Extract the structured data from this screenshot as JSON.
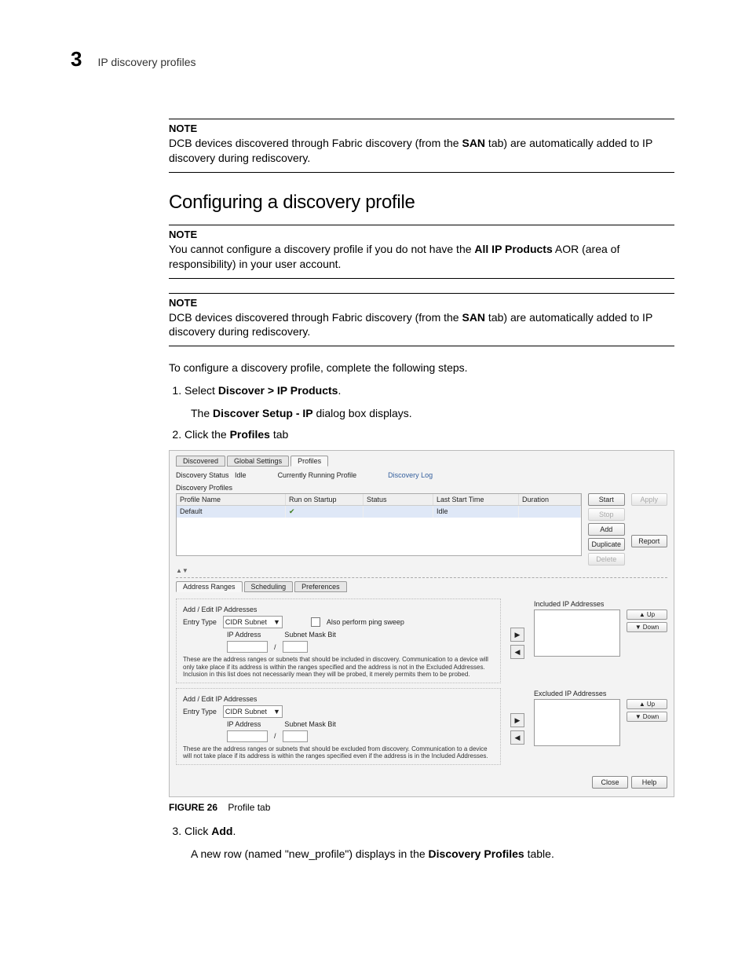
{
  "header": {
    "page_number": "3",
    "title": "IP discovery profiles"
  },
  "note1": {
    "label": "NOTE",
    "text_before": "DCB devices discovered through Fabric discovery (from the ",
    "bold": "SAN",
    "text_after": " tab) are automatically added to IP discovery during rediscovery."
  },
  "section_title": "Configuring a discovery profile",
  "note2": {
    "label": "NOTE",
    "text_before": "You cannot configure a discovery profile if you do not have the ",
    "bold": "All IP Products",
    "text_after": " AOR (area of responsibility) in your user account."
  },
  "note3": {
    "label": "NOTE",
    "text_before": "DCB devices discovered through Fabric discovery (from the ",
    "bold": "SAN",
    "text_after": " tab) are automatically added to IP discovery during rediscovery."
  },
  "intro": "To configure a discovery profile, complete the following steps.",
  "steps": {
    "s1_pre": "Select ",
    "s1_bold": "Discover > IP Products",
    "s1_post": ".",
    "s1_sub_pre": "The ",
    "s1_sub_bold": "Discover Setup - IP",
    "s1_sub_post": " dialog box displays.",
    "s2_pre": "Click the ",
    "s2_bold": "Profiles",
    "s2_post": " tab",
    "s3_pre": "Click ",
    "s3_bold": "Add",
    "s3_post": ".",
    "s3_sub_pre": "A new row (named \"new_profile\") displays in the ",
    "s3_sub_bold": "Discovery Profiles",
    "s3_sub_post": " table."
  },
  "figure": {
    "tabs": {
      "discovered": "Discovered",
      "global": "Global Settings",
      "profiles": "Profiles"
    },
    "statusrow": {
      "ds_label": "Discovery Status",
      "ds_value": "Idle",
      "crp_label": "Currently Running Profile",
      "dlog": "Discovery Log"
    },
    "dp_label": "Discovery Profiles",
    "cols": {
      "name": "Profile Name",
      "run": "Run on Startup",
      "status": "Status",
      "last": "Last Start Time",
      "dur": "Duration"
    },
    "row": {
      "name": "Default",
      "status": "Idle"
    },
    "btns": {
      "start": "Start",
      "apply": "Apply",
      "stop": "Stop",
      "add": "Add",
      "duplicate": "Duplicate",
      "report": "Report",
      "delete": "Delete"
    },
    "subtabs": {
      "addr": "Address Ranges",
      "sched": "Scheduling",
      "pref": "Preferences"
    },
    "inc": {
      "title": "Add / Edit IP Addresses",
      "entry_type_lbl": "Entry Type",
      "entry_type_val": "CIDR Subnet",
      "ping_lbl": "Also perform ping sweep",
      "ip_lbl": "IP Address",
      "mask_lbl": "Subnet Mask Bit",
      "slash": "/",
      "help": "These are the address ranges or subnets that should be included in discovery. Communication to a device will only take place if its address is within the ranges specified and the address is not in the Excluded Addresses. Inclusion in this list does not necessarily mean they will be probed, it merely permits them to be probed.",
      "list_title": "Included IP Addresses"
    },
    "exc": {
      "title": "Add / Edit IP Addresses",
      "entry_type_lbl": "Entry Type",
      "entry_type_val": "CIDR Subnet",
      "ip_lbl": "IP Address",
      "mask_lbl": "Subnet Mask Bit",
      "slash": "/",
      "help": "These are the address ranges or subnets that should be excluded from discovery. Communication to a device will not take place if its address is within the ranges specified even if the address is in the Included Addresses.",
      "list_title": "Excluded IP Addresses"
    },
    "up": "Up",
    "down": "Down",
    "close": "Close",
    "help": "Help"
  },
  "figure_caption": {
    "label": "FIGURE 26",
    "text": "Profile tab"
  }
}
